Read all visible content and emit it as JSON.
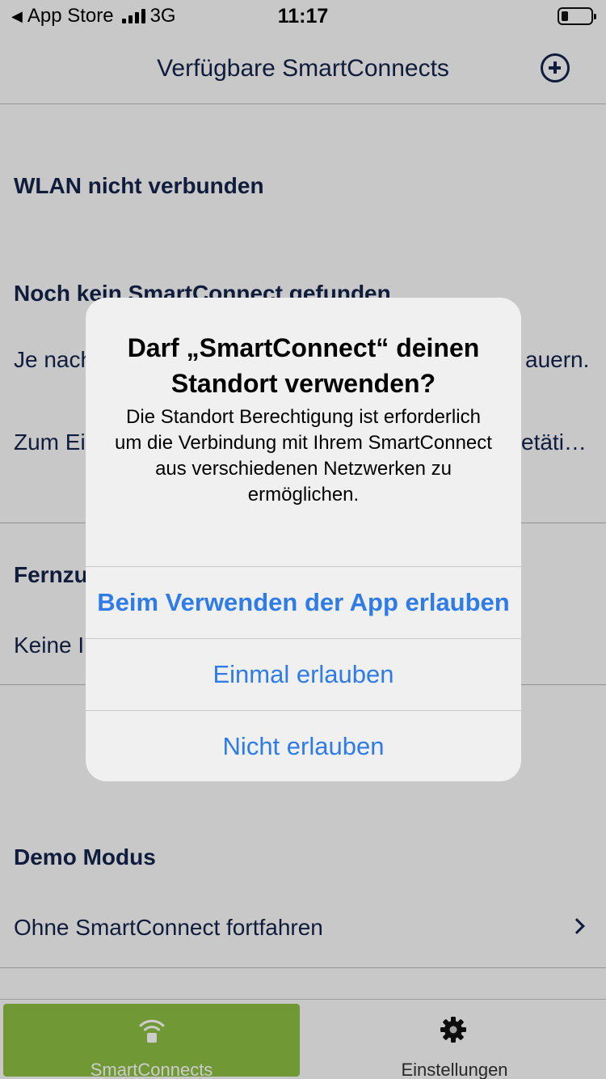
{
  "status_bar": {
    "back_app": "App Store",
    "network": "3G",
    "time": "11:17"
  },
  "nav": {
    "title": "Verfügbare SmartConnects",
    "add_icon": "plus-circle-icon"
  },
  "sections": {
    "wlan": {
      "heading": "WLAN nicht verbunden"
    },
    "not_found": {
      "heading": "Noch kein SmartConnect gefunden",
      "line1_start": "Je nach",
      "line1_end": "auern.",
      "line2_start": "Zum Ei",
      "line2_end": "etäti…"
    },
    "remote": {
      "heading": "Fernzu",
      "text": "Keine I"
    },
    "demo": {
      "heading": "Demo Modus",
      "item": "Ohne SmartConnect fortfahren"
    }
  },
  "tabs": {
    "smartconnects": {
      "label": "SmartConnects",
      "icon": "wifi-icon"
    },
    "settings": {
      "label": "Einstellungen",
      "icon": "gear-icon"
    }
  },
  "alert": {
    "title": "Darf „SmartConnect“ deinen Standort verwenden?",
    "message": "Die Standort Berechtigung ist erforderlich um die Verbindung mit Ihrem SmartConnect aus verschiedenen Netzwerken zu ermöglichen.",
    "buttons": [
      "Beim Verwenden der App erlauben",
      "Einmal erlauben",
      "Nicht erlauben"
    ]
  },
  "colors": {
    "accent": "#8dbf42",
    "primary_text": "#14234a",
    "ios_blue": "#2f7be8"
  }
}
